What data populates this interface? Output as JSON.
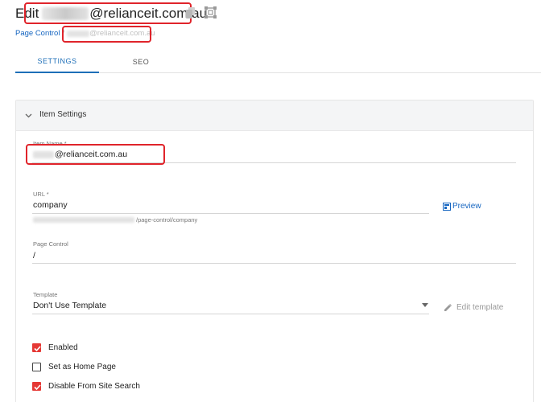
{
  "header": {
    "title_prefix": "Edit",
    "title_email": "@relianceit.com.au",
    "icons": [
      "copy-icon",
      "frame-icon"
    ]
  },
  "breadcrumb": {
    "root": "Page Control",
    "separator": "/",
    "current": "@relianceit.com.au"
  },
  "tabs": [
    {
      "label": "SETTINGS",
      "active": true
    },
    {
      "label": "SEO",
      "active": false
    }
  ],
  "section": {
    "title": "Item Settings",
    "fields": {
      "item_name": {
        "label": "Item Name *",
        "value": "@relianceit.com.au"
      },
      "url": {
        "label": "URL *",
        "value": "company",
        "hint_suffix": "/page-control/company"
      },
      "page_control": {
        "label": "Page Control",
        "value": "/"
      },
      "template": {
        "label": "Template",
        "value": "Don't Use Template"
      }
    },
    "preview_label": "Preview",
    "edit_template_label": "Edit template",
    "checkboxes": [
      {
        "label": "Enabled",
        "checked": true
      },
      {
        "label": "Set as Home Page",
        "checked": false
      },
      {
        "label": "Disable From Site Search",
        "checked": true
      }
    ]
  },
  "colors": {
    "accent": "#1e6fb8",
    "link": "#1565c0",
    "checkbox_checked": "#e53935",
    "highlight_box": "#e0242b"
  }
}
